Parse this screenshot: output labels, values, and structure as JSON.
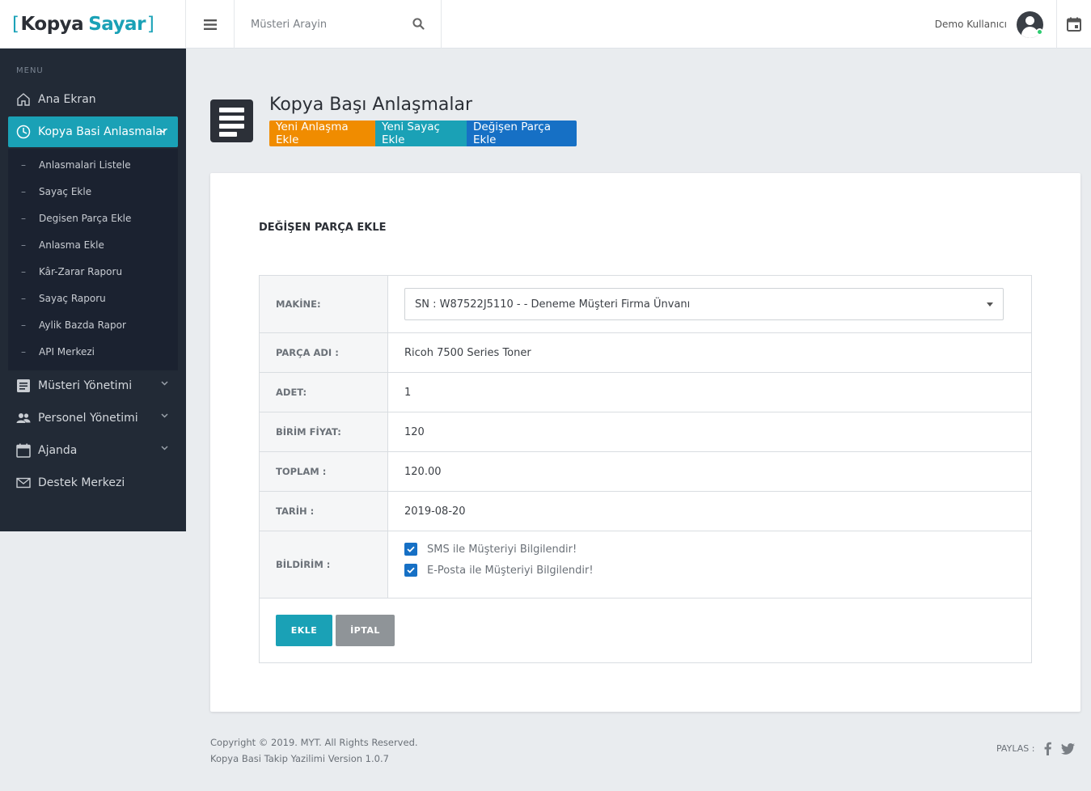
{
  "brand": {
    "bracket_open": "[",
    "name_1": "Kopya",
    "name_2": "Sayar",
    "bracket_close": "]"
  },
  "search": {
    "placeholder": "Müsteri Arayin"
  },
  "user": {
    "name": "Demo Kullanıcı"
  },
  "sidebar": {
    "menu_label": "MENU",
    "items": [
      {
        "label": "Ana Ekran",
        "icon": "home-icon"
      },
      {
        "label": "Kopya Basi Anlasmalar",
        "icon": "pie-chart-icon",
        "active": true
      },
      {
        "label": "Müsteri Yönetimi",
        "icon": "list-icon"
      },
      {
        "label": "Personel Yönetimi",
        "icon": "people-icon"
      },
      {
        "label": "Ajanda",
        "icon": "calendar-icon"
      },
      {
        "label": "Destek Merkezi",
        "icon": "mail-icon"
      }
    ],
    "submenu": [
      "Anlasmalari Listele",
      "Sayaç Ekle",
      "Degisen Parça Ekle",
      "Anlasma Ekle",
      "Kâr-Zarar Raporu",
      "Sayaç Raporu",
      "Aylik Bazda Rapor",
      "API Merkezi"
    ]
  },
  "page": {
    "title": "Kopya Başı Anlaşmalar",
    "buttons": [
      "Yeni Anlaşma Ekle",
      "Yeni Sayaç Ekle",
      "Değişen Parça Ekle"
    ],
    "button_colors": [
      "#f08c00",
      "#1aa1b6",
      "#1670c5"
    ]
  },
  "form": {
    "title": "DEĞİŞEN PARÇA EKLE",
    "machine_label": "MAKİNE:",
    "machine_value": "SN : W87522J5110 - - Deneme Müşteri Firma Ünvanı",
    "part_label": "PARÇA ADI :",
    "part_value": "Ricoh 7500 Series Toner",
    "qty_label": "ADET:",
    "qty_value": "1",
    "price_label": "BİRİM FİYAT:",
    "price_value": "120",
    "total_label": "TOPLAM :",
    "total_value": "120.00",
    "date_label": "TARİH :",
    "date_value": "2019-08-20",
    "notify_label": "BİLDİRİM :",
    "notify_sms": "SMS ile Müşteriyi Bilgilendir!",
    "notify_sms_checked": true,
    "notify_email": "E-Posta ile Müşteriyi Bilgilendir!",
    "notify_email_checked": true,
    "submit_label": "EKLE",
    "cancel_label": "İPTAL"
  },
  "footer": {
    "copyright": "Copyright © 2019. MYT. All Rights Reserved.",
    "version": "Kopya Basi Takip Yazilimi Version 1.0.7",
    "share_label": "PAYLAS :"
  },
  "colors": {
    "accent": "#1aa1b6",
    "sidebar_bg": "#222a36",
    "orange": "#f08c00",
    "blue": "#1670c5"
  }
}
